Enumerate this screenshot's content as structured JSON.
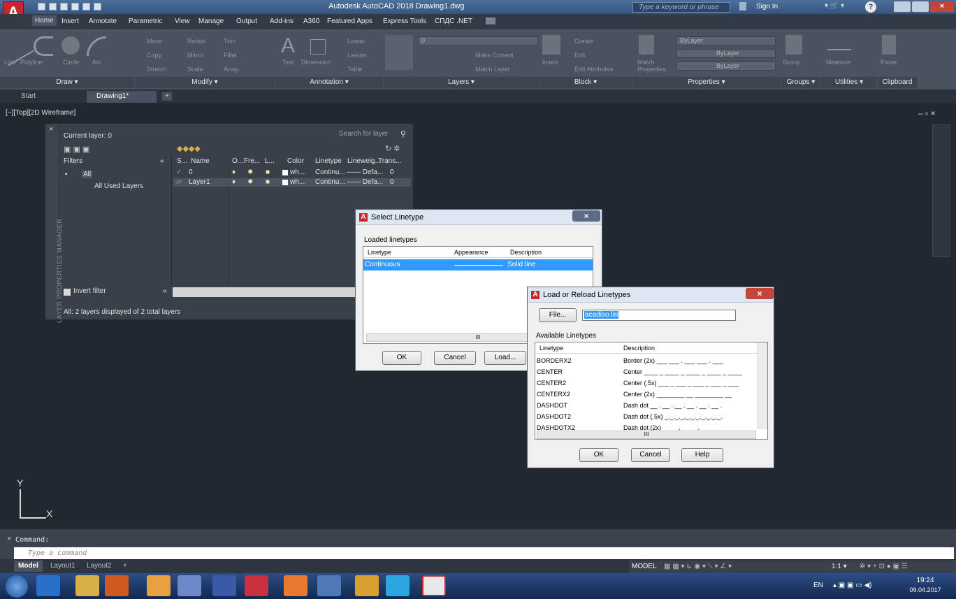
{
  "window": {
    "title": "Autodesk AutoCAD 2018   Drawing1.dwg",
    "search_placeholder": "Type a keyword or phrase",
    "sign_in": "Sign In"
  },
  "ribbon_tabs": [
    "Home",
    "Insert",
    "Annotate",
    "Parametric",
    "View",
    "Manage",
    "Output",
    "Add-ins",
    "A360",
    "Featured Apps",
    "Express Tools",
    "СПДС .NET"
  ],
  "ribbon": {
    "panels": [
      "Draw ▾",
      "Modify ▾",
      "Annotation ▾",
      "Layers ▾",
      "Block ▾",
      "Properties ▾",
      "Groups ▾",
      "Utilities ▾",
      "Clipboard"
    ],
    "draw_tools": [
      "Line",
      "Polyline",
      "Circle",
      "Arc"
    ],
    "modify_tools": [
      "Move",
      "Rotate",
      "Trim",
      "Copy",
      "Mirror",
      "Fillet",
      "Stretch",
      "Scale",
      "Array"
    ],
    "annotation_tools": [
      "Text",
      "Dimension",
      "Linear",
      "Leader",
      "Table"
    ],
    "layer_tools": [
      "Layer Properties",
      "Make Current",
      "Match Layer"
    ],
    "layer_combo": "0",
    "block_tools": [
      "Insert",
      "Create",
      "Edit",
      "Edit Attributes"
    ],
    "properties": {
      "match": "Match Properties",
      "color": "ByLayer",
      "linetype": "ByLayer",
      "lineweight": "ByLayer"
    },
    "group": "Group",
    "measure": "Measure",
    "paste": "Paste"
  },
  "file_tabs": [
    "Start",
    "Drawing1*"
  ],
  "viewport_label": "[−][Top][2D Wireframe]",
  "viewport_controls": "– ▫ ×",
  "layer_manager": {
    "vertical_title": "LAYER PROPERTIES MANAGER",
    "current_layer": "Current layer: 0",
    "search_placeholder": "Search for layer",
    "filters_header": "Filters",
    "tree_all": "All",
    "tree_used": "All Used Layers",
    "invert_filter": "Invert filter",
    "status": "All: 2 layers displayed of 2 total layers",
    "columns": [
      "S...",
      "Name",
      "O...",
      "Fre...",
      "L...",
      "Color",
      "Linetype",
      "Lineweig...",
      "Trans..."
    ],
    "rows": [
      {
        "name": "0",
        "color": "wh...",
        "linetype": "Continu...",
        "lineweight": "—— Defa...",
        "trans": "0"
      },
      {
        "name": "Layer1",
        "color": "wh...",
        "linetype": "Continu...",
        "lineweight": "—— Defa...",
        "trans": "0"
      }
    ]
  },
  "select_linetype": {
    "title": "Select Linetype",
    "group_label": "Loaded linetypes",
    "columns": [
      "Linetype",
      "Appearance",
      "Description"
    ],
    "rows": [
      {
        "linetype": "Continuous",
        "description": "Solid line"
      }
    ],
    "scroll_mark": "III",
    "buttons": [
      "OK",
      "Cancel",
      "Load..."
    ]
  },
  "load_linetypes": {
    "title": "Load or Reload Linetypes",
    "file_button": "File...",
    "file_value": "acadiso.lin",
    "group_label": "Available Linetypes",
    "columns": [
      "Linetype",
      "Description"
    ],
    "rows": [
      {
        "name": "BORDERX2",
        "desc": "Border (2x) ___ ___ . ___ ___ . ___"
      },
      {
        "name": "CENTER",
        "desc": "Center ____ _ ____ _ ____ _ ____ _ ____"
      },
      {
        "name": "CENTER2",
        "desc": "Center (.5x) ___ _ ___ _ ___ _ ___ _ ___"
      },
      {
        "name": "CENTERX2",
        "desc": "Center (2x) ________  __  ________  __"
      },
      {
        "name": "DASHDOT",
        "desc": "Dash dot __ . __ . __ . __ . __ . __ ."
      },
      {
        "name": "DASHDOT2",
        "desc": "Dash dot (.5x) _._._._._._._._._._._."
      },
      {
        "name": "DASHDOTX2",
        "desc": "Dash dot (2x) ____  .  ____  .  ____"
      }
    ],
    "scroll_mark": "III",
    "buttons": [
      "OK",
      "Cancel",
      "Help"
    ]
  },
  "ucs": {
    "x": "X",
    "y": "Y"
  },
  "command": {
    "label": "Command:",
    "placeholder": "Type a command"
  },
  "layout_tabs": [
    "Model",
    "Layout1",
    "Layout2",
    "+"
  ],
  "statusbar": {
    "model": "MODEL",
    "scale": "1:1 ▾"
  },
  "taskbar": {
    "lang": "EN",
    "time": "19:24",
    "date": "09.04.2017"
  }
}
